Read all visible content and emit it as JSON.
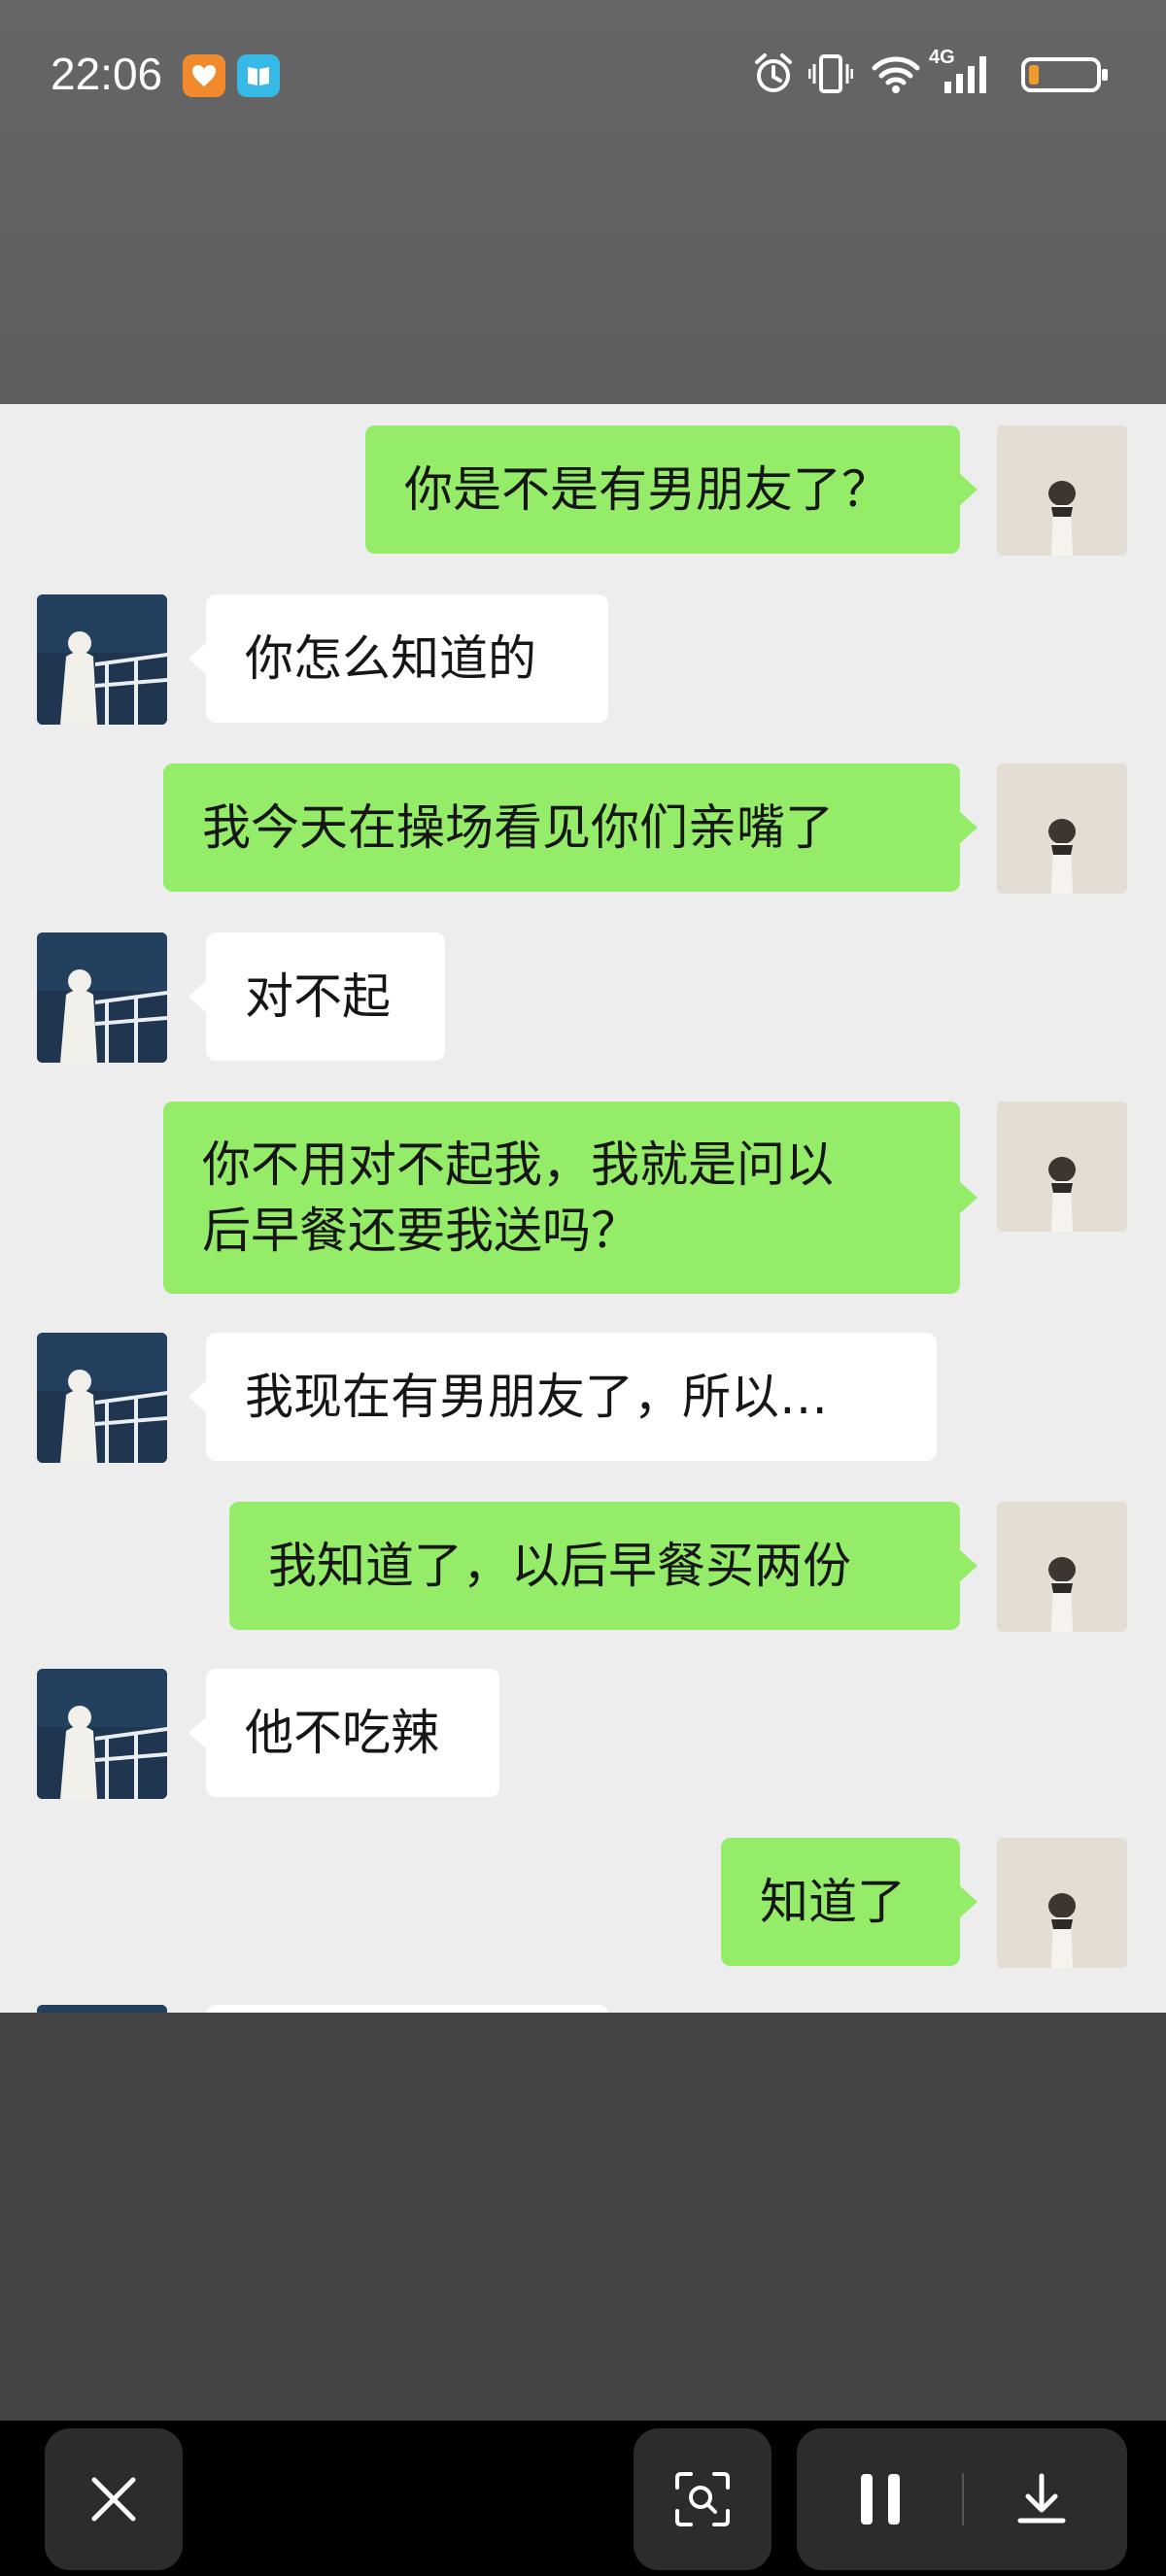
{
  "status_bar": {
    "time": "22:06",
    "network": "4G",
    "icons": [
      "heart-app-icon",
      "book-app-icon",
      "alarm-icon",
      "vibrate-icon",
      "wifi-icon",
      "signal-icon",
      "battery-low-icon"
    ],
    "battery_level": 0.15
  },
  "chat": {
    "colors": {
      "self_bubble": "#95ec69",
      "other_bubble": "#ffffff",
      "background": "#ededed"
    },
    "messages": [
      {
        "sender": "self",
        "text": "你是不是有男朋友了？"
      },
      {
        "sender": "other",
        "text": "你怎么知道的"
      },
      {
        "sender": "self",
        "text": "我今天在操场看见你们亲嘴了"
      },
      {
        "sender": "other",
        "text": "对不起"
      },
      {
        "sender": "self",
        "text": "你不用对不起我，我就是问以\n后早餐还要我送吗？"
      },
      {
        "sender": "other",
        "text": "我现在有男朋友了，所以…"
      },
      {
        "sender": "self",
        "text": "我知道了，以后早餐买两份"
      },
      {
        "sender": "other",
        "text": "他不吃辣"
      },
      {
        "sender": "self",
        "text": "知道了"
      }
    ]
  },
  "toolbar": {
    "buttons": [
      "close-icon",
      "scan-icon",
      "pause-icon",
      "download-icon"
    ]
  }
}
